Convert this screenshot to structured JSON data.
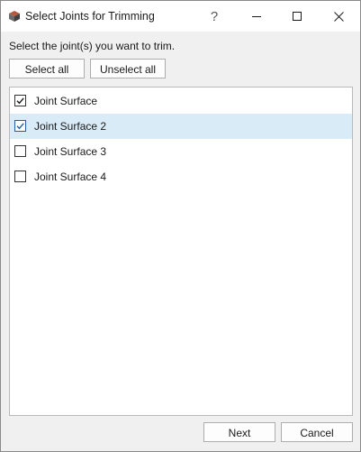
{
  "window": {
    "title": "Select Joints for Trimming",
    "icon": "app-cube-icon",
    "help_label": "?"
  },
  "instruction": "Select the joint(s) you want to trim.",
  "toolbar": {
    "select_all_label": "Select all",
    "unselect_all_label": "Unselect all"
  },
  "joints": [
    {
      "label": "Joint Surface",
      "checked": true,
      "selected": false
    },
    {
      "label": "Joint Surface 2",
      "checked": true,
      "selected": true
    },
    {
      "label": "Joint Surface 3",
      "checked": false,
      "selected": false
    },
    {
      "label": "Joint Surface 4",
      "checked": false,
      "selected": false
    }
  ],
  "footer": {
    "next_label": "Next",
    "cancel_label": "Cancel"
  },
  "colors": {
    "selection": "#d9ebf7",
    "checkbox_accent": "#1f5fa8",
    "dialog_bg": "#f0f0f0"
  }
}
